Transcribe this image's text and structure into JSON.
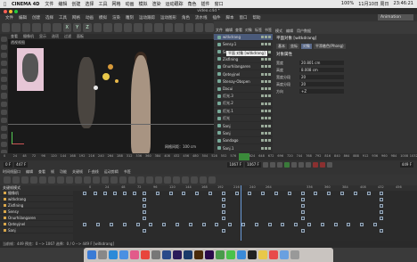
{
  "menubar": {
    "app": "CINEMA 4D",
    "items": [
      "文件",
      "编辑",
      "创建",
      "选择",
      "工具",
      "网格",
      "动画",
      "模拟",
      "渲染",
      "运动跟踪",
      "角色",
      "插件",
      "窗口"
    ],
    "status": [
      "100%",
      "11月10日 周日",
      "23:46:21"
    ]
  },
  "window": {
    "title": "video.c4d *"
  },
  "layout_label": "Animation",
  "c4d_menu": [
    "文件",
    "编辑",
    "创建",
    "选择",
    "工具",
    "网格",
    "动画",
    "模拟",
    "渲染",
    "雕刻",
    "运动跟踪",
    "运动图形",
    "角色",
    "流水线",
    "插件",
    "脚本",
    "窗口",
    "帮助"
  ],
  "toolbar_icons": [
    "undo-icon",
    "redo-icon",
    "select-icon",
    "move-icon",
    "scale-icon",
    "rotate-icon",
    "x-axis-icon",
    "y-axis-icon",
    "z-axis-icon",
    "coord-icon",
    "render-region-icon",
    "render-view-icon",
    "render-settings-icon",
    "cube-icon",
    "pen-icon",
    "subdivide-icon",
    "array-icon",
    "deformer-icon",
    "floor-icon",
    "camera-icon",
    "light-icon"
  ],
  "toolbar_letters": [
    "X",
    "Y",
    "Z"
  ],
  "viewport": {
    "menu": [
      "查看",
      "摄像机",
      "显示",
      "选项",
      "过滤",
      "面板"
    ],
    "title": "透视视图",
    "status": "网格间距：100 cm"
  },
  "objects": {
    "header": [
      "文件",
      "编辑",
      "查看",
      "对象",
      "标签",
      "书签"
    ],
    "tooltip": "平面 对象 [witkdrang]",
    "rows": [
      {
        "label": "witkdrang",
        "selected": true
      },
      {
        "label": "Sensy.1",
        "selected": false
      },
      {
        "label": "Sensy",
        "selected": false
      },
      {
        "label": "Zisfining",
        "selected": false
      },
      {
        "label": "Onurhilangaren",
        "selected": false
      },
      {
        "label": "Qeteyjnel",
        "selected": false
      },
      {
        "label": "Stenay-Obspen",
        "selected": false
      },
      {
        "label": "Dacui",
        "selected": false
      },
      {
        "label": "灯光.3",
        "selected": false
      },
      {
        "label": "灯光.2",
        "selected": false
      },
      {
        "label": "灯光.1",
        "selected": false
      },
      {
        "label": "灯光",
        "selected": false
      },
      {
        "label": "Sanj",
        "selected": false
      },
      {
        "label": "Sanj",
        "selected": false
      },
      {
        "label": "Sandago",
        "selected": false
      },
      {
        "label": "Sanj.1",
        "selected": false
      }
    ]
  },
  "attributes": {
    "tabs": [
      "模式",
      "编辑",
      "用户数据"
    ],
    "title": "平面对象 [witkdrang]",
    "subtabs": [
      "基本",
      "坐标",
      "对象",
      "平滑着色(Phong)"
    ],
    "section": "对象属性",
    "fields": [
      {
        "label": "宽度",
        "value": "20.801 cm"
      },
      {
        "label": "高度",
        "value": "8.008 cm"
      },
      {
        "label": "宽度分段",
        "value": "20"
      },
      {
        "label": "高度分段",
        "value": "20"
      },
      {
        "label": "方向",
        "value": "+Z"
      }
    ]
  },
  "timeline": {
    "ticks": [
      "0",
      "24",
      "48",
      "72",
      "96",
      "120",
      "144",
      "168",
      "192",
      "216",
      "240",
      "264",
      "288",
      "312",
      "336",
      "360",
      "384",
      "408",
      "432",
      "456",
      "480",
      "504",
      "528",
      "552",
      "576",
      "600",
      "624",
      "648",
      "672",
      "696",
      "720",
      "744",
      "768",
      "792",
      "816",
      "840",
      "864",
      "888",
      "912",
      "936",
      "960",
      "984",
      "1008",
      "1032"
    ],
    "current_frame": "447 F",
    "start": "0 F",
    "end": "1067 F",
    "end2": "1067 F",
    "frame_display": "449 F"
  },
  "dopesheet": {
    "menu": [
      "时间线窗口",
      "编辑",
      "查看",
      "帧",
      "功能",
      "关键帧",
      "F-曲线",
      "运动剪辑",
      "书签"
    ],
    "mode_label": "关键帧模式",
    "ruler": [
      "0",
      "24",
      "48",
      "72",
      "96",
      "120",
      "144",
      "168",
      "192",
      "216",
      "240",
      "264"
    ],
    "ruler_right": [
      "336",
      "360",
      "384",
      "408",
      "432",
      "456"
    ],
    "tracks": [
      {
        "label": "摄像机",
        "keys": [
          2,
          5,
          8,
          11,
          14,
          17,
          20,
          24,
          28,
          32,
          36,
          40,
          44,
          48,
          52,
          56,
          60,
          64,
          68,
          72,
          76,
          80,
          84,
          88,
          92
        ]
      },
      {
        "label": "witkdrang",
        "keys": [
          20,
          44,
          68,
          92
        ]
      },
      {
        "label": "Zisfining",
        "keys": [
          20,
          44,
          68,
          92
        ]
      },
      {
        "label": "Sensy",
        "keys": [
          20,
          44,
          68,
          92
        ]
      },
      {
        "label": "Onurhilangaren",
        "keys": [
          20,
          44,
          68,
          92
        ]
      },
      {
        "label": "Qeteyjnel",
        "keys": [
          2,
          6,
          10,
          14,
          18,
          22,
          26,
          30,
          34,
          38,
          42,
          46,
          50,
          54,
          58,
          62,
          66,
          70,
          74,
          78,
          82,
          86,
          90
        ]
      },
      {
        "label": "Sanj",
        "keys": [
          20,
          44,
          68,
          92
        ]
      }
    ],
    "status": "当前帧：449    预览：0 --> 1067    选择：0 / 0 --> 449 F   [witkdrang]"
  },
  "dock": {
    "icons": [
      "finder-icon",
      "launchpad-icon",
      "safari-icon",
      "mail-icon",
      "photos-icon",
      "music-icon",
      "settings-icon",
      "c4d-icon",
      "aftereffects-icon",
      "photoshop-icon",
      "illustrator-icon",
      "premiere-icon",
      "chrome-icon",
      "wechat-icon",
      "qq-icon",
      "terminal-icon",
      "notes-icon",
      "calendar-icon",
      "folder-icon",
      "trash-icon"
    ],
    "colors": [
      "#3a7bd5",
      "#888",
      "#2b8ad8",
      "#4a90e2",
      "#e25a8a",
      "#e8453c",
      "#777",
      "#2a4a8a",
      "#2a1a5a",
      "#1a3a6a",
      "#4a2a0a",
      "#2a0a4a",
      "#4a9a4a",
      "#4ac24a",
      "#3a8ad8",
      "#222",
      "#e8c84a",
      "#e84a4a",
      "#6aa0e0",
      "#999"
    ]
  }
}
